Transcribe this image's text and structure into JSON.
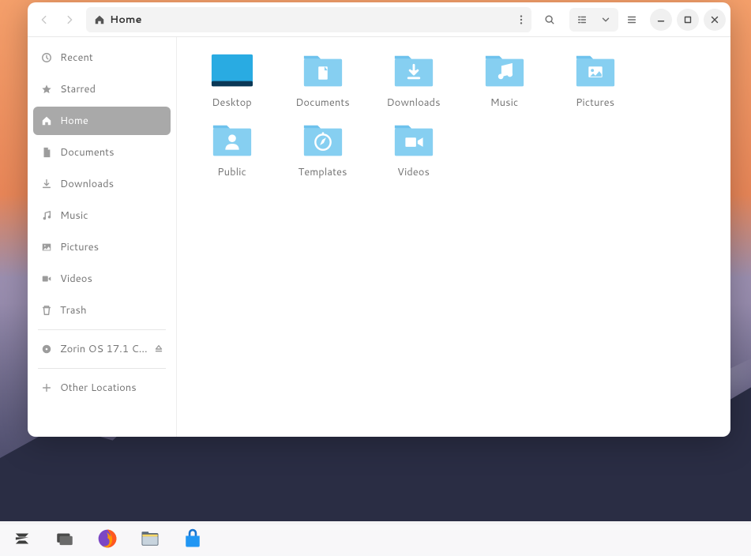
{
  "pathbar": {
    "location": "Home"
  },
  "sidebar": {
    "items": [
      {
        "id": "recent",
        "label": "Recent",
        "icon": "clock"
      },
      {
        "id": "starred",
        "label": "Starred",
        "icon": "star"
      },
      {
        "id": "home",
        "label": "Home",
        "icon": "home",
        "active": true
      },
      {
        "id": "documents",
        "label": "Documents",
        "icon": "document"
      },
      {
        "id": "downloads",
        "label": "Downloads",
        "icon": "download"
      },
      {
        "id": "music",
        "label": "Music",
        "icon": "music"
      },
      {
        "id": "pictures",
        "label": "Pictures",
        "icon": "image"
      },
      {
        "id": "videos",
        "label": "Videos",
        "icon": "video"
      },
      {
        "id": "trash",
        "label": "Trash",
        "icon": "trash"
      }
    ],
    "disk": {
      "label": "Zorin OS 17.1 C..."
    },
    "other": {
      "label": "Other Locations"
    }
  },
  "folders": [
    {
      "label": "Desktop",
      "glyph": "desktop",
      "selected": true
    },
    {
      "label": "Documents",
      "glyph": "document"
    },
    {
      "label": "Downloads",
      "glyph": "download"
    },
    {
      "label": "Music",
      "glyph": "music"
    },
    {
      "label": "Pictures",
      "glyph": "image"
    },
    {
      "label": "Public",
      "glyph": "person"
    },
    {
      "label": "Templates",
      "glyph": "compass"
    },
    {
      "label": "Videos",
      "glyph": "video"
    }
  ]
}
